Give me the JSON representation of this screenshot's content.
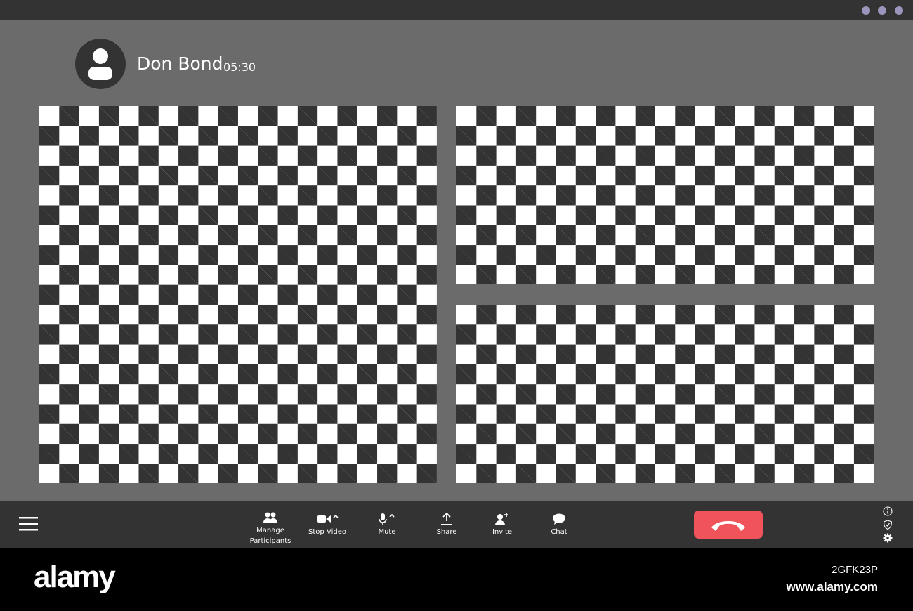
{
  "call": {
    "participant_name": "Don Bond",
    "duration": "05:30"
  },
  "window_controls": [
    "dot",
    "dot",
    "dot"
  ],
  "video_tiles": [
    {
      "label": "large-left"
    },
    {
      "label": "top-right"
    },
    {
      "label": "bottom-right"
    }
  ],
  "toolbar": {
    "manage_participants_line1": "Manage",
    "manage_participants_line2": "Participants",
    "stop_video": "Stop Video",
    "mute": "Mute",
    "share": "Share",
    "invite": "Invite",
    "chat": "Chat"
  },
  "icons": [
    "menu-icon",
    "participants-icon",
    "video-camera-icon",
    "microphone-icon",
    "share-upload-icon",
    "add-user-icon",
    "chat-bubble-icon",
    "hang-up-icon",
    "info-icon",
    "shield-icon",
    "gear-icon",
    "user-avatar-icon"
  ],
  "colors": {
    "hangup": "#f0545a",
    "window_dots": "#9b95bb",
    "bars": "#333333",
    "background": "#6b6b6b"
  },
  "footer": {
    "brand": "alamy",
    "image_id": "2GFK23P",
    "site": "www.alamy.com"
  }
}
